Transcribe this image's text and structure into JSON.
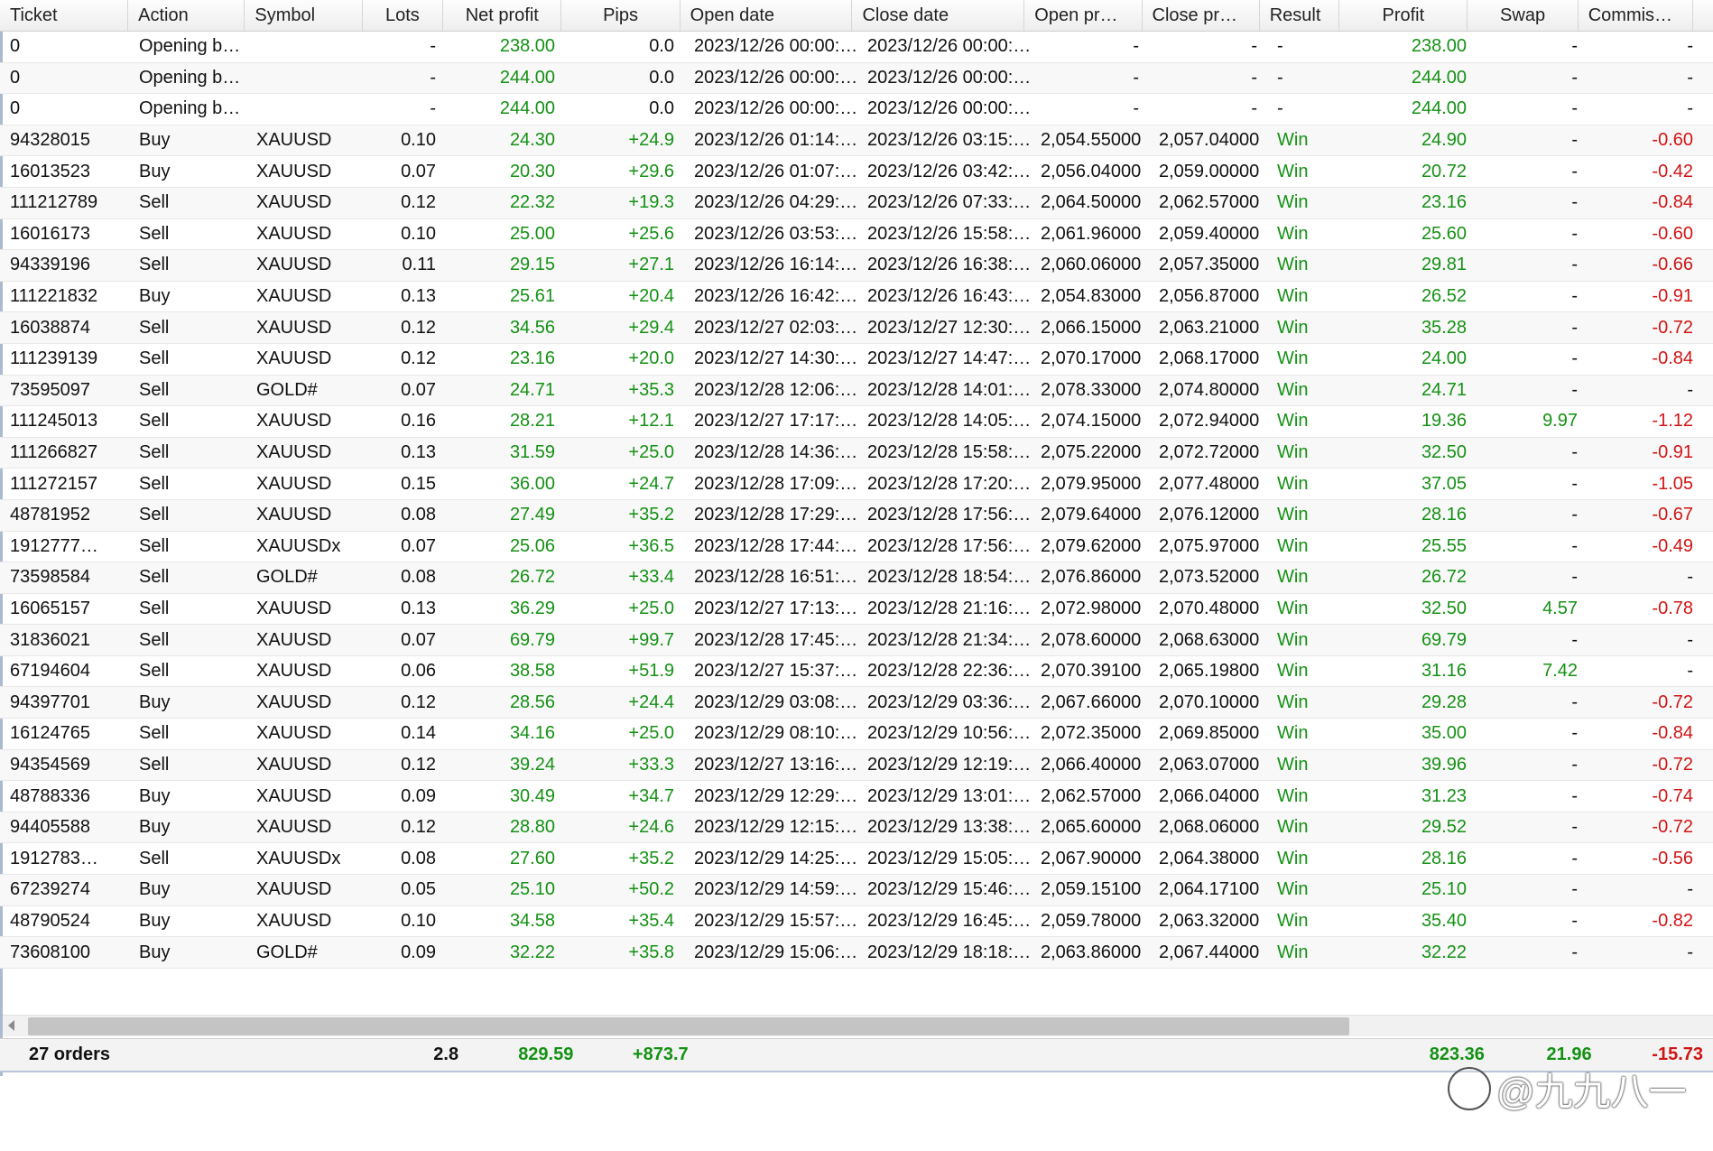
{
  "columns": [
    "Ticket",
    "Action",
    "Symbol",
    "Lots",
    "Net profit",
    "Pips",
    "Open date",
    "Close date",
    "Open pr…",
    "Close pr…",
    "Result",
    "Profit",
    "Swap",
    "Commis…"
  ],
  "rows": [
    {
      "ticket": "0",
      "action": "Opening b…",
      "symbol": "",
      "lots": "-",
      "net_profit": "238.00",
      "pips": "0.0",
      "open_date": "2023/12/26 00:00:…",
      "close_date": "2023/12/26 00:00:…",
      "open_price": "-",
      "close_price": "-",
      "result": "-",
      "profit": "238.00",
      "swap": "-",
      "commission": "-"
    },
    {
      "ticket": "0",
      "action": "Opening b…",
      "symbol": "",
      "lots": "-",
      "net_profit": "244.00",
      "pips": "0.0",
      "open_date": "2023/12/26 00:00:…",
      "close_date": "2023/12/26 00:00:…",
      "open_price": "-",
      "close_price": "-",
      "result": "-",
      "profit": "244.00",
      "swap": "-",
      "commission": "-"
    },
    {
      "ticket": "0",
      "action": "Opening b…",
      "symbol": "",
      "lots": "-",
      "net_profit": "244.00",
      "pips": "0.0",
      "open_date": "2023/12/26 00:00:…",
      "close_date": "2023/12/26 00:00:…",
      "open_price": "-",
      "close_price": "-",
      "result": "-",
      "profit": "244.00",
      "swap": "-",
      "commission": "-"
    },
    {
      "ticket": "94328015",
      "action": "Buy",
      "symbol": "XAUUSD",
      "lots": "0.10",
      "net_profit": "24.30",
      "pips": "+24.9",
      "open_date": "2023/12/26 01:14:…",
      "close_date": "2023/12/26 03:15:…",
      "open_price": "2,054.55000",
      "close_price": "2,057.04000",
      "result": "Win",
      "profit": "24.90",
      "swap": "-",
      "commission": "-0.60"
    },
    {
      "ticket": "16013523",
      "action": "Buy",
      "symbol": "XAUUSD",
      "lots": "0.07",
      "net_profit": "20.30",
      "pips": "+29.6",
      "open_date": "2023/12/26 01:07:…",
      "close_date": "2023/12/26 03:42:…",
      "open_price": "2,056.04000",
      "close_price": "2,059.00000",
      "result": "Win",
      "profit": "20.72",
      "swap": "-",
      "commission": "-0.42"
    },
    {
      "ticket": "111212789",
      "action": "Sell",
      "symbol": "XAUUSD",
      "lots": "0.12",
      "net_profit": "22.32",
      "pips": "+19.3",
      "open_date": "2023/12/26 04:29:…",
      "close_date": "2023/12/26 07:33:…",
      "open_price": "2,064.50000",
      "close_price": "2,062.57000",
      "result": "Win",
      "profit": "23.16",
      "swap": "-",
      "commission": "-0.84"
    },
    {
      "ticket": "16016173",
      "action": "Sell",
      "symbol": "XAUUSD",
      "lots": "0.10",
      "net_profit": "25.00",
      "pips": "+25.6",
      "open_date": "2023/12/26 03:53:…",
      "close_date": "2023/12/26 15:58:…",
      "open_price": "2,061.96000",
      "close_price": "2,059.40000",
      "result": "Win",
      "profit": "25.60",
      "swap": "-",
      "commission": "-0.60"
    },
    {
      "ticket": "94339196",
      "action": "Sell",
      "symbol": "XAUUSD",
      "lots": "0.11",
      "net_profit": "29.15",
      "pips": "+27.1",
      "open_date": "2023/12/26 16:14:…",
      "close_date": "2023/12/26 16:38:…",
      "open_price": "2,060.06000",
      "close_price": "2,057.35000",
      "result": "Win",
      "profit": "29.81",
      "swap": "-",
      "commission": "-0.66"
    },
    {
      "ticket": "111221832",
      "action": "Buy",
      "symbol": "XAUUSD",
      "lots": "0.13",
      "net_profit": "25.61",
      "pips": "+20.4",
      "open_date": "2023/12/26 16:42:…",
      "close_date": "2023/12/26 16:43:…",
      "open_price": "2,054.83000",
      "close_price": "2,056.87000",
      "result": "Win",
      "profit": "26.52",
      "swap": "-",
      "commission": "-0.91"
    },
    {
      "ticket": "16038874",
      "action": "Sell",
      "symbol": "XAUUSD",
      "lots": "0.12",
      "net_profit": "34.56",
      "pips": "+29.4",
      "open_date": "2023/12/27 02:03:…",
      "close_date": "2023/12/27 12:30:…",
      "open_price": "2,066.15000",
      "close_price": "2,063.21000",
      "result": "Win",
      "profit": "35.28",
      "swap": "-",
      "commission": "-0.72"
    },
    {
      "ticket": "111239139",
      "action": "Sell",
      "symbol": "XAUUSD",
      "lots": "0.12",
      "net_profit": "23.16",
      "pips": "+20.0",
      "open_date": "2023/12/27 14:30:…",
      "close_date": "2023/12/27 14:47:…",
      "open_price": "2,070.17000",
      "close_price": "2,068.17000",
      "result": "Win",
      "profit": "24.00",
      "swap": "-",
      "commission": "-0.84"
    },
    {
      "ticket": "73595097",
      "action": "Sell",
      "symbol": "GOLD#",
      "lots": "0.07",
      "net_profit": "24.71",
      "pips": "+35.3",
      "open_date": "2023/12/28 12:06:…",
      "close_date": "2023/12/28 14:01:…",
      "open_price": "2,078.33000",
      "close_price": "2,074.80000",
      "result": "Win",
      "profit": "24.71",
      "swap": "-",
      "commission": "-"
    },
    {
      "ticket": "111245013",
      "action": "Sell",
      "symbol": "XAUUSD",
      "lots": "0.16",
      "net_profit": "28.21",
      "pips": "+12.1",
      "open_date": "2023/12/27 17:17:…",
      "close_date": "2023/12/28 14:05:…",
      "open_price": "2,074.15000",
      "close_price": "2,072.94000",
      "result": "Win",
      "profit": "19.36",
      "swap": "9.97",
      "commission": "-1.12"
    },
    {
      "ticket": "111266827",
      "action": "Sell",
      "symbol": "XAUUSD",
      "lots": "0.13",
      "net_profit": "31.59",
      "pips": "+25.0",
      "open_date": "2023/12/28 14:36:…",
      "close_date": "2023/12/28 15:58:…",
      "open_price": "2,075.22000",
      "close_price": "2,072.72000",
      "result": "Win",
      "profit": "32.50",
      "swap": "-",
      "commission": "-0.91"
    },
    {
      "ticket": "111272157",
      "action": "Sell",
      "symbol": "XAUUSD",
      "lots": "0.15",
      "net_profit": "36.00",
      "pips": "+24.7",
      "open_date": "2023/12/28 17:09:…",
      "close_date": "2023/12/28 17:20:…",
      "open_price": "2,079.95000",
      "close_price": "2,077.48000",
      "result": "Win",
      "profit": "37.05",
      "swap": "-",
      "commission": "-1.05"
    },
    {
      "ticket": "48781952",
      "action": "Sell",
      "symbol": "XAUUSD",
      "lots": "0.08",
      "net_profit": "27.49",
      "pips": "+35.2",
      "open_date": "2023/12/28 17:29:…",
      "close_date": "2023/12/28 17:56:…",
      "open_price": "2,079.64000",
      "close_price": "2,076.12000",
      "result": "Win",
      "profit": "28.16",
      "swap": "-",
      "commission": "-0.67"
    },
    {
      "ticket": "1912777…",
      "action": "Sell",
      "symbol": "XAUUSDx",
      "lots": "0.07",
      "net_profit": "25.06",
      "pips": "+36.5",
      "open_date": "2023/12/28 17:44:…",
      "close_date": "2023/12/28 17:56:…",
      "open_price": "2,079.62000",
      "close_price": "2,075.97000",
      "result": "Win",
      "profit": "25.55",
      "swap": "-",
      "commission": "-0.49"
    },
    {
      "ticket": "73598584",
      "action": "Sell",
      "symbol": "GOLD#",
      "lots": "0.08",
      "net_profit": "26.72",
      "pips": "+33.4",
      "open_date": "2023/12/28 16:51:…",
      "close_date": "2023/12/28 18:54:…",
      "open_price": "2,076.86000",
      "close_price": "2,073.52000",
      "result": "Win",
      "profit": "26.72",
      "swap": "-",
      "commission": "-"
    },
    {
      "ticket": "16065157",
      "action": "Sell",
      "symbol": "XAUUSD",
      "lots": "0.13",
      "net_profit": "36.29",
      "pips": "+25.0",
      "open_date": "2023/12/27 17:13:…",
      "close_date": "2023/12/28 21:16:…",
      "open_price": "2,072.98000",
      "close_price": "2,070.48000",
      "result": "Win",
      "profit": "32.50",
      "swap": "4.57",
      "commission": "-0.78"
    },
    {
      "ticket": "31836021",
      "action": "Sell",
      "symbol": "XAUUSD",
      "lots": "0.07",
      "net_profit": "69.79",
      "pips": "+99.7",
      "open_date": "2023/12/28 17:45:…",
      "close_date": "2023/12/28 21:34:…",
      "open_price": "2,078.60000",
      "close_price": "2,068.63000",
      "result": "Win",
      "profit": "69.79",
      "swap": "-",
      "commission": "-"
    },
    {
      "ticket": "67194604",
      "action": "Sell",
      "symbol": "XAUUSD",
      "lots": "0.06",
      "net_profit": "38.58",
      "pips": "+51.9",
      "open_date": "2023/12/27 15:37:…",
      "close_date": "2023/12/28 22:36:…",
      "open_price": "2,070.39100",
      "close_price": "2,065.19800",
      "result": "Win",
      "profit": "31.16",
      "swap": "7.42",
      "commission": "-"
    },
    {
      "ticket": "94397701",
      "action": "Buy",
      "symbol": "XAUUSD",
      "lots": "0.12",
      "net_profit": "28.56",
      "pips": "+24.4",
      "open_date": "2023/12/29 03:08:…",
      "close_date": "2023/12/29 03:36:…",
      "open_price": "2,067.66000",
      "close_price": "2,070.10000",
      "result": "Win",
      "profit": "29.28",
      "swap": "-",
      "commission": "-0.72"
    },
    {
      "ticket": "16124765",
      "action": "Sell",
      "symbol": "XAUUSD",
      "lots": "0.14",
      "net_profit": "34.16",
      "pips": "+25.0",
      "open_date": "2023/12/29 08:10:…",
      "close_date": "2023/12/29 10:56:…",
      "open_price": "2,072.35000",
      "close_price": "2,069.85000",
      "result": "Win",
      "profit": "35.00",
      "swap": "-",
      "commission": "-0.84"
    },
    {
      "ticket": "94354569",
      "action": "Sell",
      "symbol": "XAUUSD",
      "lots": "0.12",
      "net_profit": "39.24",
      "pips": "+33.3",
      "open_date": "2023/12/27 13:16:…",
      "close_date": "2023/12/29 12:19:…",
      "open_price": "2,066.40000",
      "close_price": "2,063.07000",
      "result": "Win",
      "profit": "39.96",
      "swap": "-",
      "commission": "-0.72"
    },
    {
      "ticket": "48788336",
      "action": "Buy",
      "symbol": "XAUUSD",
      "lots": "0.09",
      "net_profit": "30.49",
      "pips": "+34.7",
      "open_date": "2023/12/29 12:29:…",
      "close_date": "2023/12/29 13:01:…",
      "open_price": "2,062.57000",
      "close_price": "2,066.04000",
      "result": "Win",
      "profit": "31.23",
      "swap": "-",
      "commission": "-0.74"
    },
    {
      "ticket": "94405588",
      "action": "Buy",
      "symbol": "XAUUSD",
      "lots": "0.12",
      "net_profit": "28.80",
      "pips": "+24.6",
      "open_date": "2023/12/29 12:15:…",
      "close_date": "2023/12/29 13:38:…",
      "open_price": "2,065.60000",
      "close_price": "2,068.06000",
      "result": "Win",
      "profit": "29.52",
      "swap": "-",
      "commission": "-0.72"
    },
    {
      "ticket": "1912783…",
      "action": "Sell",
      "symbol": "XAUUSDx",
      "lots": "0.08",
      "net_profit": "27.60",
      "pips": "+35.2",
      "open_date": "2023/12/29 14:25:…",
      "close_date": "2023/12/29 15:05:…",
      "open_price": "2,067.90000",
      "close_price": "2,064.38000",
      "result": "Win",
      "profit": "28.16",
      "swap": "-",
      "commission": "-0.56"
    },
    {
      "ticket": "67239274",
      "action": "Buy",
      "symbol": "XAUUSD",
      "lots": "0.05",
      "net_profit": "25.10",
      "pips": "+50.2",
      "open_date": "2023/12/29 14:59:…",
      "close_date": "2023/12/29 15:46:…",
      "open_price": "2,059.15100",
      "close_price": "2,064.17100",
      "result": "Win",
      "profit": "25.10",
      "swap": "-",
      "commission": "-"
    },
    {
      "ticket": "48790524",
      "action": "Buy",
      "symbol": "XAUUSD",
      "lots": "0.10",
      "net_profit": "34.58",
      "pips": "+35.4",
      "open_date": "2023/12/29 15:57:…",
      "close_date": "2023/12/29 16:45:…",
      "open_price": "2,059.78000",
      "close_price": "2,063.32000",
      "result": "Win",
      "profit": "35.40",
      "swap": "-",
      "commission": "-0.82"
    },
    {
      "ticket": "73608100",
      "action": "Buy",
      "symbol": "GOLD#",
      "lots": "0.09",
      "net_profit": "32.22",
      "pips": "+35.8",
      "open_date": "2023/12/29 15:06:…",
      "close_date": "2023/12/29 18:18:…",
      "open_price": "2,063.86000",
      "close_price": "2,067.44000",
      "result": "Win",
      "profit": "32.22",
      "swap": "-",
      "commission": "-"
    }
  ],
  "totals": {
    "orders": "27 orders",
    "lots": "2.8",
    "net_profit": "829.59",
    "pips": "+873.7",
    "profit": "823.36",
    "swap": "21.96",
    "commission": "-15.73"
  },
  "watermark": {
    "icon": "知",
    "text": "@九九八一"
  },
  "colors": {
    "positive": "#149114",
    "negative": "#d11515"
  }
}
